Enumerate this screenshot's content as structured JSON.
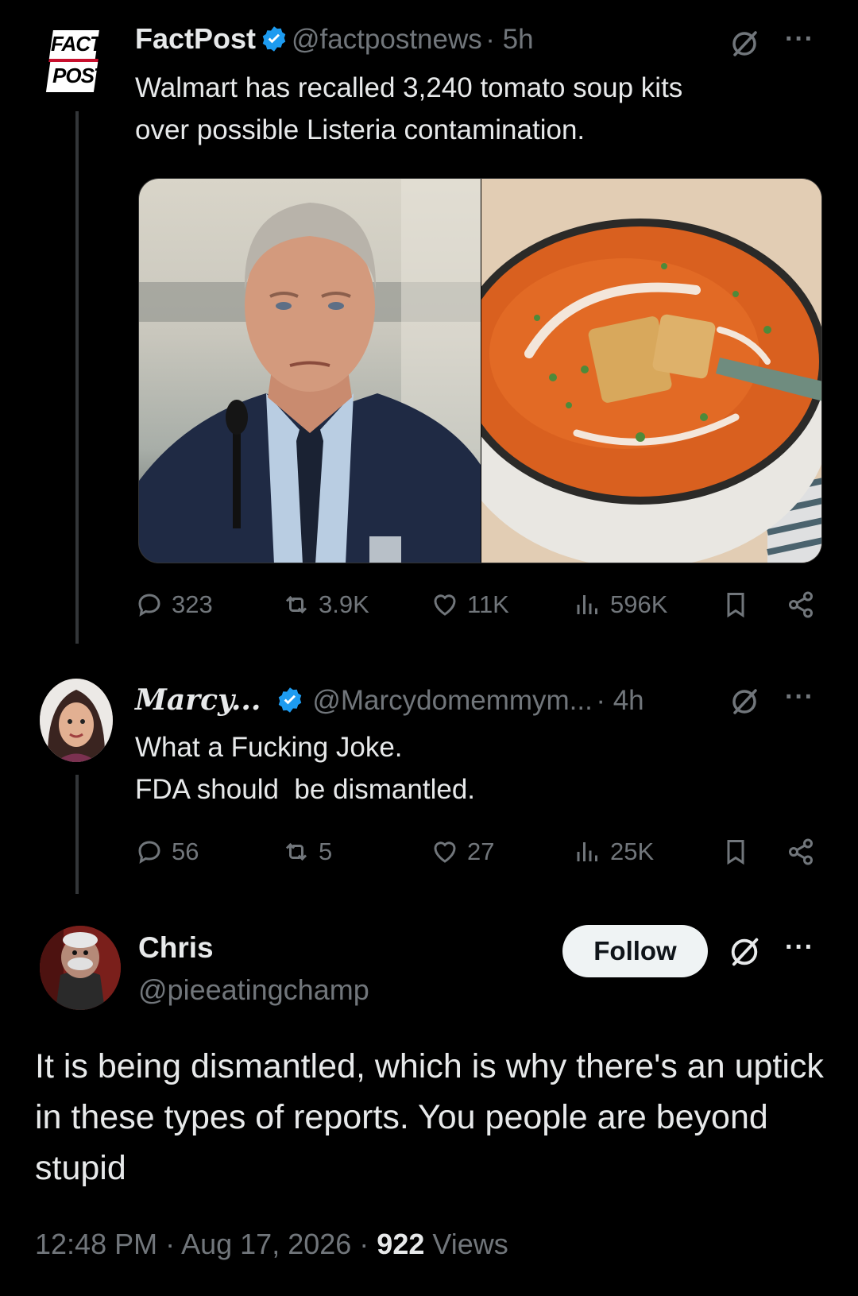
{
  "tweet1": {
    "avatar_text_top": "FACT",
    "avatar_text_bottom": "POST",
    "name": "FactPost",
    "handle": "@factpostnews",
    "time": "· 5h",
    "text_line1": "Walmart has recalled 3,240 tomato soup kits",
    "text_line2": "over possible Listeria contamination.",
    "replies": "323",
    "reposts": "3.9K",
    "likes": "11K",
    "views": "596K"
  },
  "tweet2": {
    "name": "Marcy...",
    "handle": "@Marcydomemmym...",
    "time": "· 4h",
    "text_line1": "What a Fucking Joke.",
    "text_line2": "FDA should  be dismantled.",
    "replies": "56",
    "reposts": "5",
    "likes": "27",
    "views": "25K"
  },
  "tweet3": {
    "name": "Chris",
    "handle": "@pieeatingchamp",
    "follow_label": "Follow",
    "text": "It is being dismantled, which is why there's an uptick in these types of reports. You people are beyond stupid",
    "timestamp": "12:48 PM · Aug 17, 2026 ·",
    "views_count": "922",
    "views_label": "Views"
  },
  "colors": {
    "background": "#000000",
    "text": "#e7e9ea",
    "muted": "#71767b",
    "verified": "#1d9bf0",
    "thread_line": "#333639"
  },
  "icons": [
    "reply-icon",
    "repost-icon",
    "like-icon",
    "views-icon",
    "bookmark-icon",
    "share-icon",
    "grok-icon",
    "more-icon",
    "verified-badge-icon"
  ]
}
